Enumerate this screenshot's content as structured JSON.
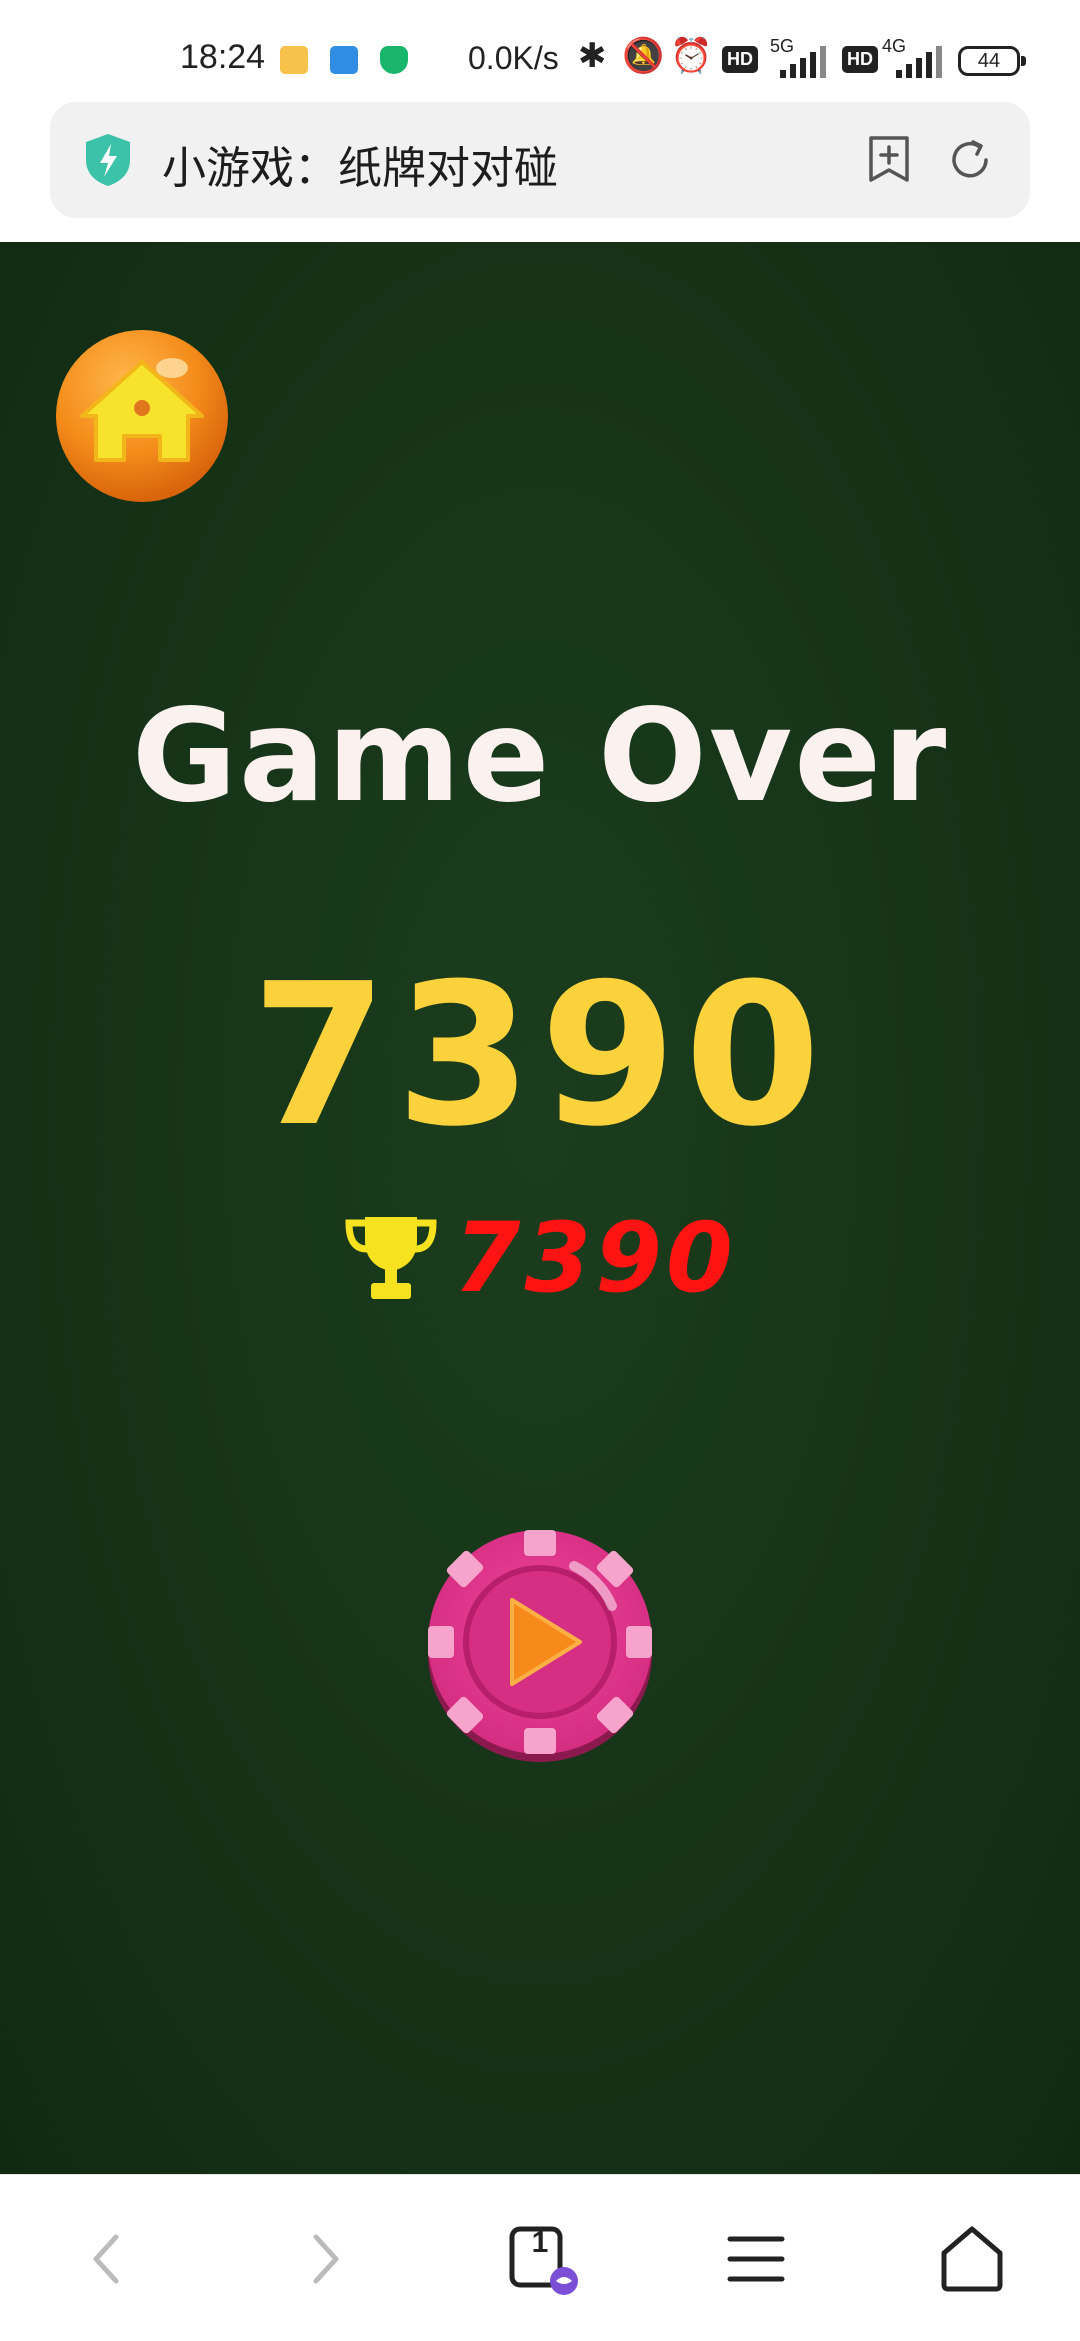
{
  "status_bar": {
    "time": "18:24",
    "net_speed": "0.0K/s",
    "signal1_label": "5G",
    "signal2_label": "4G",
    "hd_badge": "HD",
    "battery": "44"
  },
  "address_bar": {
    "title": "小游戏：纸牌对对碰"
  },
  "game": {
    "heading": "Game Over",
    "score": "7390",
    "best_score": "7390"
  },
  "bottom_nav": {
    "tab_count": "1"
  },
  "colors": {
    "game_bg": "#173519",
    "score": "#fcd23c",
    "best_score": "#ff1313",
    "home_button": "#f08a1c",
    "play_button": "#e7358e"
  }
}
